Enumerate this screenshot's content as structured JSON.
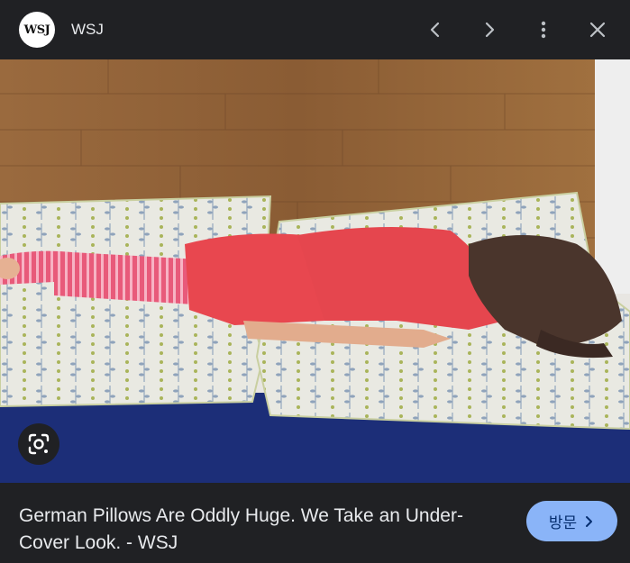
{
  "header": {
    "logo_text": "WSJ",
    "source_name": "WSJ",
    "icons": {
      "prev": "chevron-left-icon",
      "next": "chevron-right-icon",
      "more": "more-vert-icon",
      "close": "close-icon"
    }
  },
  "image": {
    "lens_icon": "google-lens-icon"
  },
  "caption": {
    "title": "German Pillows Are Oddly Huge. We Take an Under-Cover Look. - WSJ",
    "visit_label": "방문"
  },
  "colors": {
    "background": "#202124",
    "text": "#e8eaed",
    "accent_button": "#8ab4f8",
    "accent_button_text": "#062e6f"
  }
}
